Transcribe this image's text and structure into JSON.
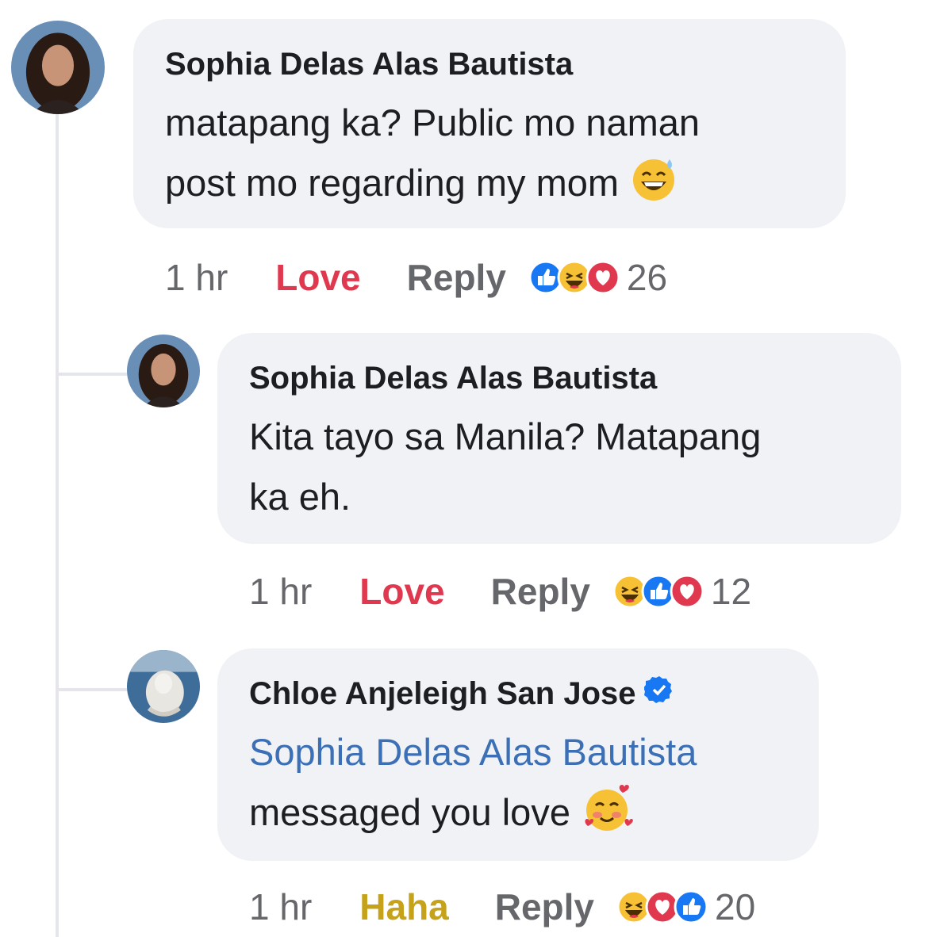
{
  "comments": [
    {
      "author": "Sophia Delas Alas Bautista",
      "lines": [
        "matapang ka? Public mo naman",
        "post mo regarding my mom"
      ],
      "emoji": "grinning-sweat-emoji",
      "time": "1 hr",
      "reaction": "Love",
      "reply": "Reply",
      "reaction_icons": [
        "like-icon",
        "haha-icon",
        "love-icon"
      ],
      "count": "26"
    },
    {
      "author": "Sophia Delas Alas Bautista",
      "lines": [
        "Kita tayo sa Manila? Matapang",
        "ka eh."
      ],
      "time": "1 hr",
      "reaction": "Love",
      "reply": "Reply",
      "reaction_icons": [
        "haha-icon",
        "like-icon",
        "love-icon"
      ],
      "count": "12"
    },
    {
      "author": "Chloe Anjeleigh San Jose",
      "verified": true,
      "mention": "Sophia Delas Alas Bautista",
      "lines": [
        "messaged you love"
      ],
      "emoji": "smiling-hearts-emoji",
      "time": "1 hr",
      "reaction": "Haha",
      "reply": "Reply",
      "reaction_icons": [
        "haha-icon",
        "love-icon",
        "like-icon"
      ],
      "count": "20"
    }
  ],
  "colors": {
    "bubble": "#f0f2f5",
    "love": "#e0394f",
    "haha": "#c6a21a",
    "mention": "#3b6fb6",
    "like_blue": "#1877f2",
    "verified_blue": "#1877f2"
  }
}
